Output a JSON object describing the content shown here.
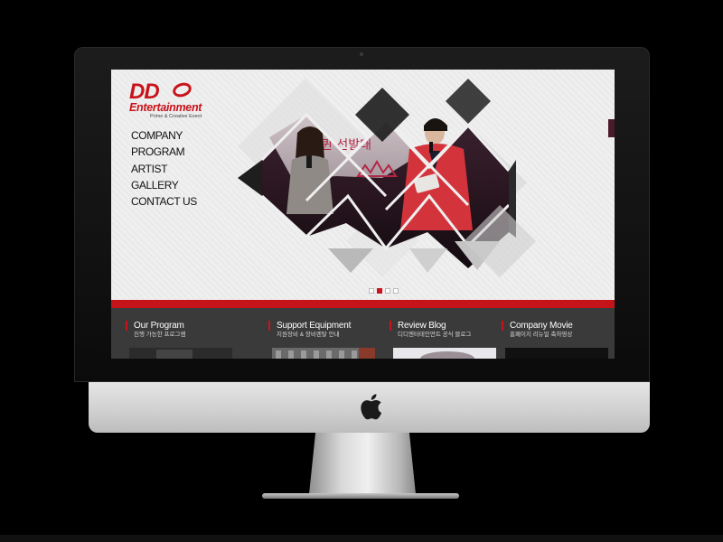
{
  "brand": {
    "logo_main": "DD",
    "logo_sub": "Entertainment",
    "tagline": "Prime & Creative Event",
    "accent_color": "#c8141a"
  },
  "nav": {
    "items": [
      "COMPANY",
      "PROGRAM",
      "ARTIST",
      "GALLERY",
      "CONTACT US"
    ]
  },
  "hero": {
    "banner_text": "퀸  선발대",
    "slides_count": 4,
    "active_slide": 2
  },
  "sections": [
    {
      "title": "Our Program",
      "subtitle": "진행 가능한 프로그램"
    },
    {
      "title": "Support Equipment",
      "subtitle": "지원장비 & 장비렌탈 안내"
    },
    {
      "title": "Review Blog",
      "subtitle": "디디엔터테인먼트 공식 블로그"
    },
    {
      "title": "Company Movie",
      "subtitle": "홈페이지 리뉴얼 축하영상"
    }
  ],
  "device": {
    "logo_icon": "apple-logo-icon",
    "frame_color": "#0b0b0b",
    "chin_color": "#d8d8d8"
  }
}
